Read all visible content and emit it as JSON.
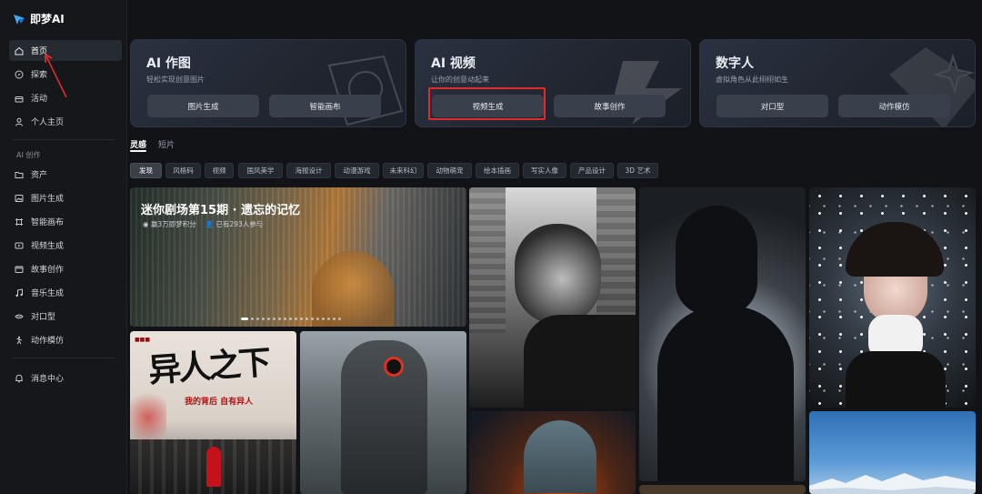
{
  "app": {
    "name": "即梦AI"
  },
  "sidebar": {
    "items": [
      {
        "label": "首页",
        "icon": "home-icon",
        "active": true
      },
      {
        "label": "探索",
        "icon": "compass-icon"
      },
      {
        "label": "活动",
        "icon": "gift-icon"
      },
      {
        "label": "个人主页",
        "icon": "user-icon"
      }
    ],
    "section_label": "AI 创作",
    "create_items": [
      {
        "label": "资产",
        "icon": "folder-icon"
      },
      {
        "label": "图片生成",
        "icon": "image-icon"
      },
      {
        "label": "智能画布",
        "icon": "canvas-icon"
      },
      {
        "label": "视频生成",
        "icon": "video-icon"
      },
      {
        "label": "故事创作",
        "icon": "film-icon"
      },
      {
        "label": "音乐生成",
        "icon": "music-icon"
      },
      {
        "label": "对口型",
        "icon": "lipsync-icon"
      },
      {
        "label": "动作模仿",
        "icon": "motion-icon"
      }
    ],
    "messages": {
      "label": "消息中心",
      "icon": "bell-icon"
    }
  },
  "cards": [
    {
      "title": "AI 作图",
      "subtitle": "轻松实现创意图片",
      "buttons": [
        "图片生成",
        "智能画布"
      ]
    },
    {
      "title": "AI 视频",
      "subtitle": "让你的创意动起来",
      "buttons": [
        "视频生成",
        "故事创作"
      ]
    },
    {
      "title": "数字人",
      "subtitle": "虚拟角色从此栩栩如生",
      "buttons": [
        "对口型",
        "动作模仿"
      ]
    }
  ],
  "tabs": [
    {
      "label": "灵感",
      "active": true
    },
    {
      "label": "短片"
    }
  ],
  "chips": [
    {
      "label": "发现",
      "active": true
    },
    {
      "label": "风格码"
    },
    {
      "label": "视频"
    },
    {
      "label": "国风美学"
    },
    {
      "label": "海报设计"
    },
    {
      "label": "动漫游戏"
    },
    {
      "label": "未来科幻"
    },
    {
      "label": "动物萌宠"
    },
    {
      "label": "绘本插画"
    },
    {
      "label": "写实人像"
    },
    {
      "label": "产品设计"
    },
    {
      "label": "3D 艺术"
    }
  ],
  "banner": {
    "title": "迷你剧场第15期 · 遗忘的记忆",
    "reward": "赢3万即梦积分",
    "participants": "已有293人参与",
    "slide_count": 18,
    "current_slide": 1
  },
  "poster": {
    "title": "异人之下",
    "subtitle": "我的背后 自有异人"
  },
  "colors": {
    "background": "#111317",
    "sidebar": "#15171b",
    "card_button": "#3a404b",
    "highlight": "#e22a2a"
  }
}
